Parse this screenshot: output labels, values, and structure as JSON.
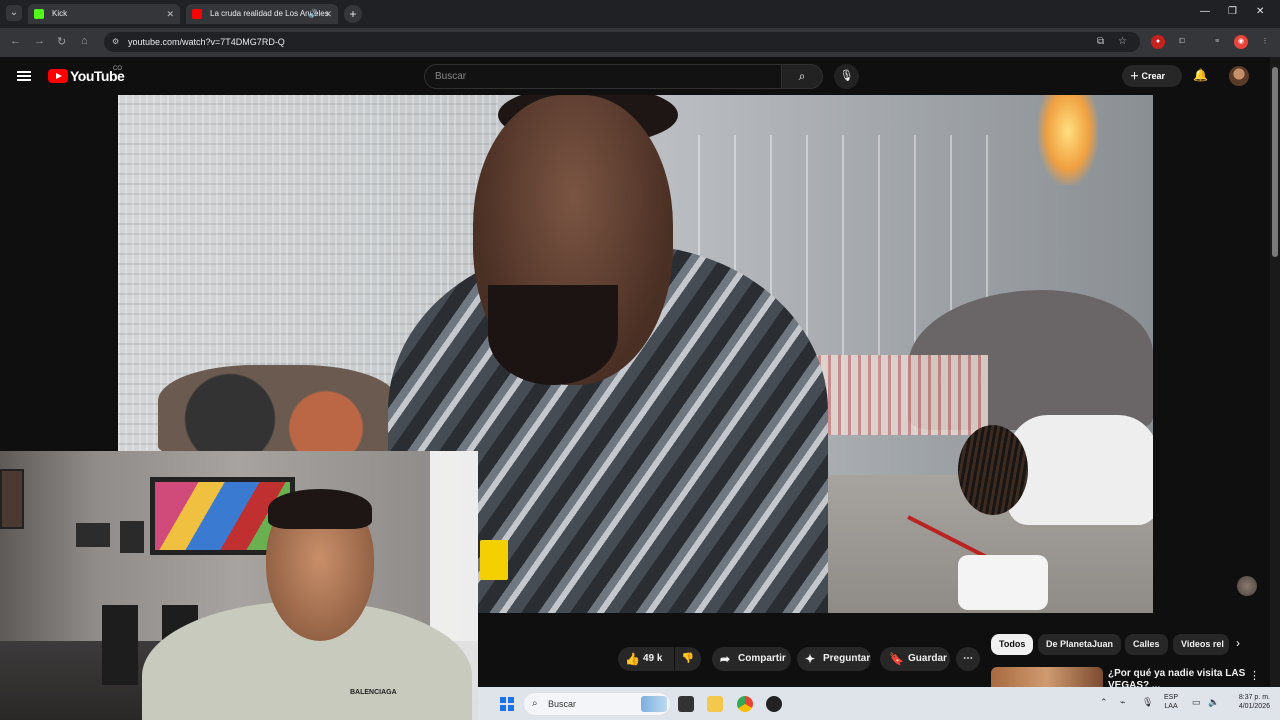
{
  "browser": {
    "tabs": [
      {
        "label": "Kick",
        "active": false,
        "favicon_color": "#53fc18"
      },
      {
        "label": "La cruda realidad de Los Angeles",
        "active": true,
        "favicon_color": "#ff0000"
      }
    ],
    "new_tab_icon": "plus-icon",
    "url": "youtube.com/watch?v=7T4DMG7RD-Q",
    "window_controls": [
      "minimize-icon",
      "restore-icon",
      "close-icon"
    ]
  },
  "youtube": {
    "logo_text": "YouTube",
    "country_code": "CO",
    "search_placeholder": "Buscar",
    "create_label": "Crear",
    "accent": "#ff0000"
  },
  "video": {
    "actions": {
      "likes": "49 k",
      "share_label": "Compartir",
      "ask_label": "Preguntar",
      "save_label": "Guardar"
    }
  },
  "webcam": {
    "shirt_text": "BALENCIAGA"
  },
  "chips": [
    "Todos",
    "De PlanetaJuan",
    "Calles",
    "Videos rel"
  ],
  "recommended": {
    "title": "¿Por qué ya nadie visita LAS VEGAS? ..."
  },
  "taskbar": {
    "search_placeholder": "Buscar",
    "language": [
      "ESP",
      "LAA"
    ],
    "time": "8:37 p. m.",
    "date": "4/01/2026"
  }
}
